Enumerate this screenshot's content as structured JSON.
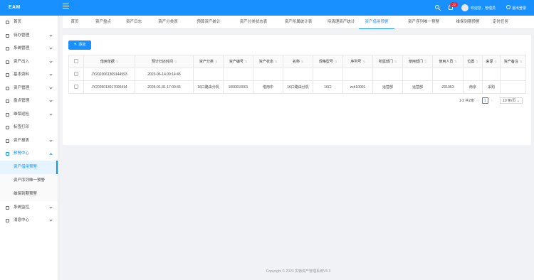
{
  "header": {
    "logo": "EAM",
    "badge_count": "22",
    "welcome": "欢迎您，管理员",
    "logout": "退出登录",
    "color": "#1890ff"
  },
  "sidebar": {
    "items": [
      {
        "label": "首页",
        "icon": "home-icon",
        "arrow": false
      },
      {
        "label": "待办管理",
        "icon": "todo-icon",
        "arrow": true
      },
      {
        "label": "系统管理",
        "icon": "settings-icon",
        "arrow": true
      },
      {
        "label": "资产出入",
        "icon": "inout-icon",
        "arrow": true
      },
      {
        "label": "基本资料",
        "icon": "profile-icon",
        "arrow": true
      },
      {
        "label": "资产管理",
        "icon": "asset-icon",
        "arrow": true
      },
      {
        "label": "盘点管理",
        "icon": "inventory-icon",
        "arrow": true
      },
      {
        "label": "维保巡检",
        "icon": "wrench-icon",
        "arrow": true
      },
      {
        "label": "标签打印",
        "icon": "print-icon",
        "arrow": false
      },
      {
        "label": "资产报表",
        "icon": "chart-icon",
        "arrow": true
      },
      {
        "label": "预警中心",
        "icon": "warning-icon",
        "arrow": true,
        "open": true
      },
      {
        "label": "系统监控",
        "icon": "monitor-icon",
        "arrow": true
      },
      {
        "label": "消息中心",
        "icon": "message-icon",
        "arrow": true
      }
    ],
    "submenu": [
      {
        "label": "资产借用预警",
        "active": true
      },
      {
        "label": "资产序列唯一预警",
        "active": false
      },
      {
        "label": "维保到期预警",
        "active": false
      }
    ]
  },
  "tabs": [
    {
      "label": "首页"
    },
    {
      "label": "资产盘点"
    },
    {
      "label": "资产日志"
    },
    {
      "label": "资产分类表"
    },
    {
      "label": "预算资产统计"
    },
    {
      "label": "资产分类状态表"
    },
    {
      "label": "资产所属统计表"
    },
    {
      "label": "待清理资产统计"
    },
    {
      "label": "资产借用预警",
      "active": true
    },
    {
      "label": "资产序列唯一预警"
    },
    {
      "label": "维保到期预警"
    },
    {
      "label": "定时任务"
    }
  ],
  "toolbar": {
    "add_label": "添加"
  },
  "table": {
    "columns": [
      "借用单据",
      "预计归还时间",
      "资产分类",
      "资产编号",
      "资产状态",
      "名称",
      "规格型号",
      "序列号",
      "所属部门",
      "使用部门",
      "使用人员",
      "位置",
      "来源",
      "资产备注"
    ],
    "rows": [
      [
        "JY2023061309144593",
        "2023-06-14 09:14:45",
        "",
        "",
        "",
        "",
        "",
        "",
        "",
        "",
        "",
        "",
        "",
        ""
      ],
      [
        "JY2025013017000414",
        "2025-01-31 17:00:33",
        "16口路由分机",
        "1000010001",
        "借用中",
        "16口路由分机",
        "16口",
        "zxh10001",
        "运营部",
        "运营部",
        "Z01053",
        "南京",
        "采购",
        ""
      ]
    ]
  },
  "pagination": {
    "total": "1-2 共2条",
    "page": "1",
    "page_size": "10 条/页"
  },
  "footer": "Copyright © 2023 实物资产管理系统V5.3"
}
